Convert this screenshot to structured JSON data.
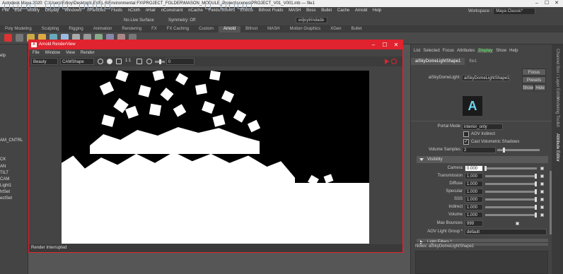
{
  "app": {
    "title": "Autodesk Maya 2020: C:\\Users\\Edjoy\\Desktop\\LEVEL 6\\Environmental FX\\PROJECT_FOLDER\\MASON_MODULE_Project\\scenes\\PROJECT_V01_V001.mb   —   file1",
    "workspace_label": "Workspace :",
    "workspace_value": "Maya Classic*"
  },
  "menubar": [
    "File",
    "Edit",
    "Modify",
    "Display",
    "Windows",
    "nParticles",
    "Fluids",
    "nCloth",
    "nHair",
    "nConstraint",
    "nCache",
    "Fields/Solvers",
    "Effects",
    "Bifrost Fluids",
    "MASH",
    "Boss",
    "Bullet",
    "Cache",
    "Arnold",
    "Help"
  ],
  "statusline": {
    "live_surface": "No Live Surface",
    "symmetry": "Symmetry: Off",
    "user": "edjoytrindade"
  },
  "shelf_tabs": [
    "Poly Modeling",
    "Sculpting",
    "Rigging",
    "Animation",
    "Rendering",
    "FX",
    "FX Caching",
    "Custom",
    "Arnold",
    "Bifrost",
    "MASH",
    "Motion Graphics",
    "XGen",
    "Bullet"
  ],
  "shelf_active": "Arnold",
  "outliner": [
    "elp",
    "",
    "",
    "",
    "",
    "",
    "",
    "",
    "",
    "",
    "",
    "",
    "",
    "AM_CNTRL",
    "",
    "",
    "CK",
    "AN",
    "TILT",
    "CAM",
    "Light1",
    "htSet",
    "ectSet"
  ],
  "renderview": {
    "title": "Arnold RenderView",
    "menus": [
      "File",
      "Window",
      "View",
      "Render"
    ],
    "aov": "Beauty",
    "camera": "CAMShape",
    "ratio": "1:1",
    "exposure": "0",
    "status": "Render Interrupted"
  },
  "attr_editor": {
    "menus": [
      "List",
      "Selected",
      "Focus",
      "Attributes",
      "Display",
      "Show",
      "Help"
    ],
    "highlighted_menu": "Display",
    "tabs": [
      "aiSkyDomeLightShape1",
      "file1"
    ],
    "node_label": "aiSkyDomeLight:",
    "node_name": "aiSkyDomeLightShape1",
    "focus": "Focus",
    "presets": "Presets",
    "show": "Show",
    "hide": "Hide",
    "portal_mode_label": "Portal Mode",
    "portal_mode": "interior_only",
    "aov_indirect": "AOV Indirect",
    "cast_volumetric": "Cast Volumetric Shadows",
    "volume_samples_label": "Volume Samples",
    "volume_samples": "2",
    "visibility_section": "Visibility",
    "visibility": [
      {
        "label": "Camera",
        "value": "0.000"
      },
      {
        "label": "Transmission",
        "value": "1.000"
      },
      {
        "label": "Diffuse",
        "value": "1.000"
      },
      {
        "label": "Specular",
        "value": "1.000"
      },
      {
        "label": "SSS",
        "value": "1.000"
      },
      {
        "label": "Indirect",
        "value": "1.000"
      },
      {
        "label": "Volume",
        "value": "1.000"
      }
    ],
    "max_bounces_label": "Max Bounces",
    "max_bounces": "999",
    "aov_light_group_label": "AOV Light Group *",
    "aov_light_group": "default",
    "light_filters_section": "Light Filters *",
    "notes_label": "Notes:",
    "notes_value": "aiSkyDomeLightShape1"
  },
  "right_strip": [
    "Channel Box / Layer Editor",
    "Modeling Toolkit",
    "Attribute Editor"
  ],
  "colors": {
    "arnold_red": "#e0232e",
    "highlight_green": "#66ff66"
  }
}
